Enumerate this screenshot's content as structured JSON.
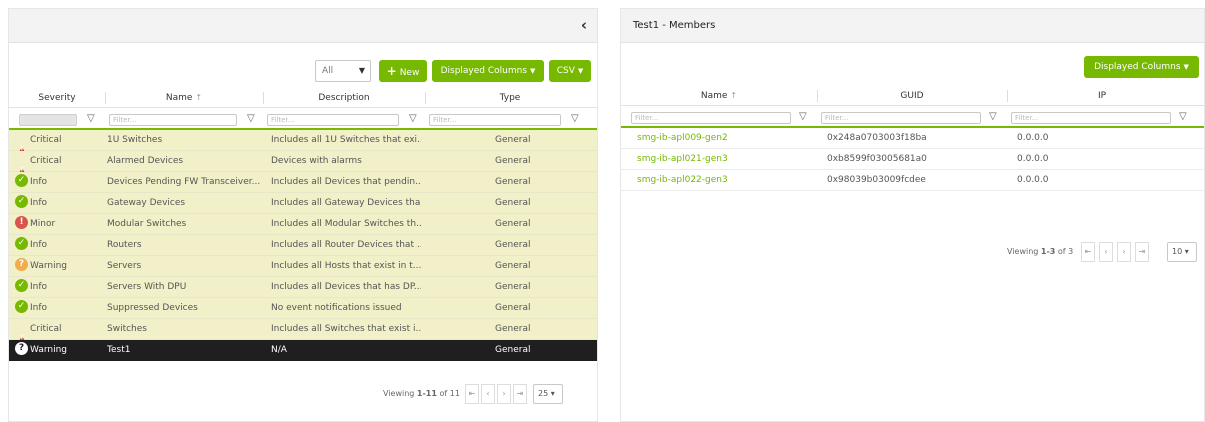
{
  "left_panel": {
    "toolbar": {
      "filter_select": "All",
      "new_label": "New",
      "displayed_columns_label": "Displayed Columns",
      "csv_label": "CSV"
    },
    "columns": [
      "Severity",
      "Name",
      "Description",
      "Type"
    ],
    "filter_placeholder": "Filter...",
    "rows": [
      {
        "severity": "Critical",
        "icon": "critical-triangle-icon",
        "name": "1U Switches",
        "description": "Includes all 1U Switches that exi...",
        "type": "General"
      },
      {
        "severity": "Critical",
        "icon": "critical-triangle-icon",
        "name": "Alarmed Devices",
        "description": "Devices with alarms",
        "type": "General"
      },
      {
        "severity": "Info",
        "icon": "info-check-icon",
        "name": "Devices Pending FW Transceiver...",
        "description": "Includes all Devices that pendin...",
        "type": "General"
      },
      {
        "severity": "Info",
        "icon": "info-check-icon",
        "name": "Gateway Devices",
        "description": "Includes all Gateway Devices tha...",
        "type": "General"
      },
      {
        "severity": "Minor",
        "icon": "minor-exclamation-icon",
        "name": "Modular Switches",
        "description": "Includes all Modular Switches th...",
        "type": "General"
      },
      {
        "severity": "Info",
        "icon": "info-check-icon",
        "name": "Routers",
        "description": "Includes all Router Devices that ...",
        "type": "General"
      },
      {
        "severity": "Warning",
        "icon": "warning-question-icon",
        "name": "Servers",
        "description": "Includes all Hosts that exist in t...",
        "type": "General"
      },
      {
        "severity": "Info",
        "icon": "info-check-icon",
        "name": "Servers With DPU",
        "description": "Includes all Devices that has DP...",
        "type": "General"
      },
      {
        "severity": "Info",
        "icon": "info-check-icon",
        "name": "Suppressed Devices",
        "description": "No event notifications issued",
        "type": "General"
      },
      {
        "severity": "Critical",
        "icon": "critical-triangle-icon",
        "name": "Switches",
        "description": "Includes all Switches that exist i...",
        "type": "General"
      },
      {
        "severity": "Warning",
        "icon": "warning-question-icon",
        "name": "Test1",
        "description": "N/A",
        "type": "General"
      }
    ],
    "pager": {
      "viewing_prefix": "Viewing ",
      "viewing_range": "1-11",
      "viewing_suffix": " of 11",
      "page_size": "25"
    }
  },
  "right_panel": {
    "title": "Test1 - Members",
    "displayed_columns_label": "Displayed Columns",
    "columns": [
      "Name",
      "GUID",
      "IP"
    ],
    "filter_placeholder": "Filter...",
    "rows": [
      {
        "name": "smg-ib-apl009-gen2",
        "guid": "0x248a0703003f18ba",
        "ip": "0.0.0.0"
      },
      {
        "name": "smg-ib-apl021-gen3",
        "guid": "0xb8599f03005681a0",
        "ip": "0.0.0.0"
      },
      {
        "name": "smg-ib-apl022-gen3",
        "guid": "0x98039b03009fcdee",
        "ip": "0.0.0.0"
      }
    ],
    "pager": {
      "viewing_prefix": "Viewing ",
      "viewing_range": "1-3",
      "viewing_suffix": " of 3",
      "page_size": "10"
    }
  },
  "colors": {
    "accent": "#76b900",
    "critical": "#c9302c",
    "minor": "#d9534f",
    "warning": "#f0ad4e",
    "row_highlight": "#f1f0c8",
    "selected_row": "#1f1f1f"
  }
}
